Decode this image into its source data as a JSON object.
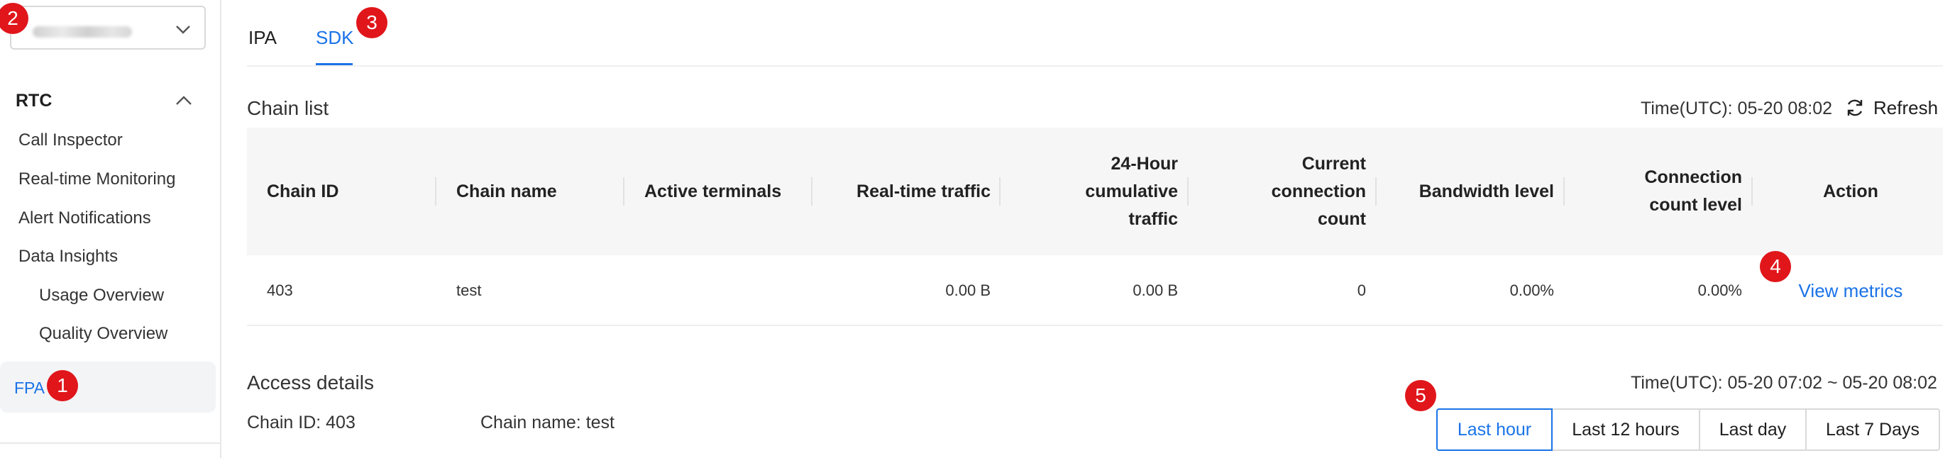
{
  "sidebar": {
    "section": "RTC",
    "items": [
      "Call Inspector",
      "Real-time Monitoring",
      "Alert Notifications",
      "Data Insights"
    ],
    "subitems": [
      "Usage Overview",
      "Quality Overview"
    ],
    "active_item": "FPA"
  },
  "tabs": [
    "IPA",
    "SDK"
  ],
  "active_tab": "SDK",
  "chain_list": {
    "title": "Chain list",
    "time": "Time(UTC): 05-20 08:02",
    "refresh_label": "Refresh",
    "columns": [
      [
        "Chain ID"
      ],
      [
        "Chain name"
      ],
      [
        "Active terminals"
      ],
      [
        "Real-time traffic"
      ],
      [
        "24-Hour",
        "cumulative",
        "traffic"
      ],
      [
        "Current",
        "connection",
        "count"
      ],
      [
        "Bandwidth level"
      ],
      [
        "Connection",
        "count level"
      ],
      [
        "Action"
      ]
    ],
    "rows": [
      {
        "chain_id": "403",
        "chain_name": "test",
        "active_terminals": "",
        "realtime_traffic": "0.00 B",
        "cumulative_traffic": "0.00 B",
        "connection_count": "0",
        "bandwidth_level": "0.00%",
        "connection_count_level": "0.00%",
        "action": "View metrics"
      }
    ]
  },
  "access_details": {
    "title": "Access details",
    "time_range": "Time(UTC): 05-20 07:02 ~ 05-20 08:02",
    "chain_id": "Chain ID: 403",
    "chain_name": "Chain name: test",
    "ranges": [
      "Last hour",
      "Last 12 hours",
      "Last day",
      "Last 7 Days"
    ],
    "active_range": "Last hour"
  },
  "badges": [
    "1",
    "2",
    "3",
    "4",
    "5"
  ],
  "colors": {
    "accent": "#1a73e8",
    "badge": "#e0161b",
    "header_bg": "#f6f6f7"
  },
  "icons": {
    "select_chevron": "chevron-down-icon",
    "section_chevron": "chevron-up-icon",
    "refresh": "refresh-icon"
  }
}
